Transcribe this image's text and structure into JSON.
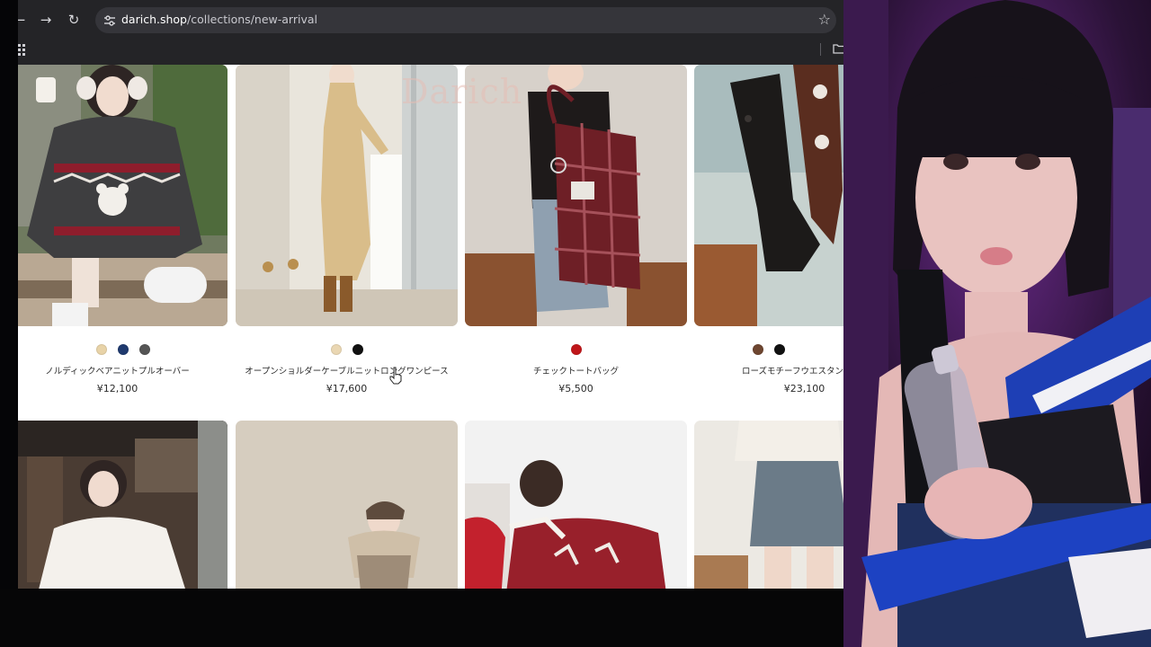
{
  "browser": {
    "url_host": "darich.shop",
    "url_path": "/collections/new-arrival",
    "back_icon": "back-arrow-icon",
    "forward_icon": "forward-arrow-icon",
    "reload_icon": "reload-icon",
    "bookmark_icon": "star-icon"
  },
  "page": {
    "watermark": "Darich",
    "products_row1": [
      {
        "name": "ノルディックベアニットプルオーバー",
        "price": "¥12,100",
        "swatches": [
          "#e8d3a8",
          "#1f3a6e",
          "#555555"
        ]
      },
      {
        "name": "オープンショルダーケーブルニットロングワンピース",
        "price": "¥17,600",
        "swatches": [
          "#ead7b3",
          "#111111"
        ]
      },
      {
        "name": "チェックトートバッグ",
        "price": "¥5,500",
        "swatches": [
          "#c0161a"
        ]
      },
      {
        "name": "ローズモチーフウエスタン",
        "price": "¥23,100",
        "swatches": [
          "#6e4630",
          "#111111"
        ]
      }
    ]
  }
}
